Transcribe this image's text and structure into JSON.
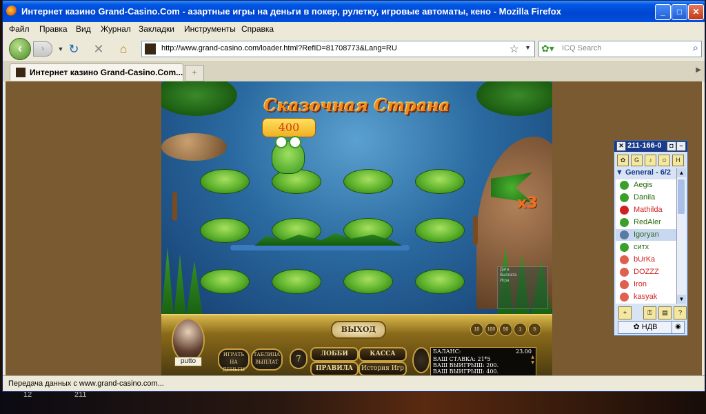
{
  "window": {
    "title": "Интернет казино Grand-Casino.Com - азартные игры на деньги в покер, рулетку, игровые автоматы, кено - Mozilla Firefox",
    "minimize": "_",
    "maximize": "□",
    "close": "✕"
  },
  "menu": [
    "Файл",
    "Правка",
    "Вид",
    "Журнал",
    "Закладки",
    "Инструменты",
    "Справка"
  ],
  "nav": {
    "url": "http://www.grand-casino.com/loader.html?RefID=81708773&Lang=RU",
    "search_placeholder": "ICQ Search",
    "back_icon": "back-arrow-icon",
    "forward_icon": "forward-arrow-icon",
    "reload_icon": "reload-icon",
    "stop_icon": "stop-icon",
    "home_icon": "home-icon"
  },
  "tabs": [
    {
      "label": "Интернет казино Grand-Casino.Com..."
    }
  ],
  "tab_controls": {
    "new_tab": "+",
    "scroll": "▶"
  },
  "game": {
    "title": "Сказочная Страна",
    "bet_bubble": "400",
    "multiplier": "x3",
    "side_panel": [
      "Дата",
      "Выплата",
      "Игра"
    ],
    "exit_label": "ВЫХОД",
    "player_name": "putto",
    "oval_buttons": [
      "ИГРАТЬ НА ДЕНЬГИ",
      "ТАБЛИЦА ВЫПЛАТ"
    ],
    "chips": [
      "10",
      "100",
      "50",
      "1",
      "5"
    ],
    "buttons": {
      "lobby": "ЛОББИ",
      "cashier": "КАССА",
      "rules": "ПРАВИЛА",
      "history": "История Игр"
    },
    "info": {
      "balance_label": "БАЛАНС:",
      "balance_value": "23.00",
      "bet_line": "ВАШ СТАВКА: 21*5",
      "win_line_1": "ВАШ ВЫИГРЫШ: 200.",
      "win_line_2": "ВАШ ВЫИГРЫШ: 400."
    }
  },
  "icq": {
    "title": "211-166-0",
    "group": "General - 6/2",
    "contacts": [
      {
        "name": "Aegis",
        "color": "#2a6a10"
      },
      {
        "name": "Danila",
        "color": "#2a6a10"
      },
      {
        "name": "Mathilda",
        "color": "#d02020"
      },
      {
        "name": "RedAler",
        "color": "#2a6a10"
      },
      {
        "name": "Igoryan",
        "color": "#2a6a10"
      },
      {
        "name": "ситх",
        "color": "#2a6a10"
      },
      {
        "name": "bUrKa",
        "color": "#d02020"
      },
      {
        "name": "DOZZZ",
        "color": "#d02020"
      },
      {
        "name": "Iron",
        "color": "#d02020"
      },
      {
        "name": "kasyak",
        "color": "#d02020"
      }
    ],
    "status": "НДВ"
  },
  "status_bar": "Передача данных с www.grand-casino.com...",
  "desktop": {
    "left": "12",
    "right": "211"
  }
}
